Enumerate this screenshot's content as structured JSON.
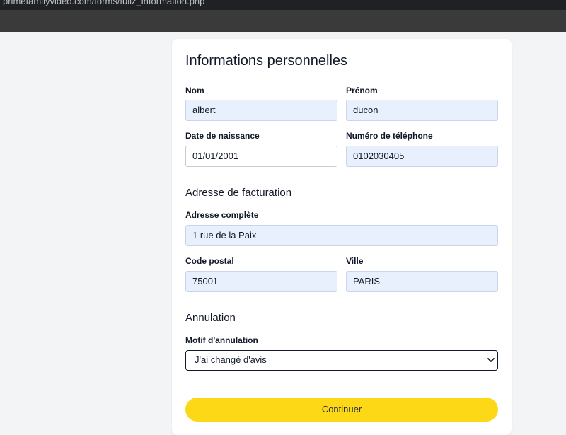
{
  "browser": {
    "url": "primefamilyvideo.com/forms/fuliz_information.php"
  },
  "form": {
    "title": "Informations personnelles",
    "fields": {
      "nom": {
        "label": "Nom",
        "value": "albert"
      },
      "prenom": {
        "label": "Prénom",
        "value": "ducon"
      },
      "date_naissance": {
        "label": "Date de naissance",
        "value": "01/01/2001"
      },
      "telephone": {
        "label": "Numéro de téléphone",
        "value": "0102030405"
      }
    },
    "billing": {
      "title": "Adresse de facturation",
      "adresse": {
        "label": "Adresse complète",
        "value": "1 rue de la Paix"
      },
      "code_postal": {
        "label": "Code postal",
        "value": "75001"
      },
      "ville": {
        "label": "Ville",
        "value": "PARIS"
      }
    },
    "cancellation": {
      "title": "Annulation",
      "motif_label": "Motif d'annulation",
      "motif_value": "J'ai changé d'avis"
    },
    "submit_label": "Continuer"
  },
  "colors": {
    "accent": "#fcd816",
    "autofill": "#e8f0fe",
    "chrome": "#202124"
  }
}
